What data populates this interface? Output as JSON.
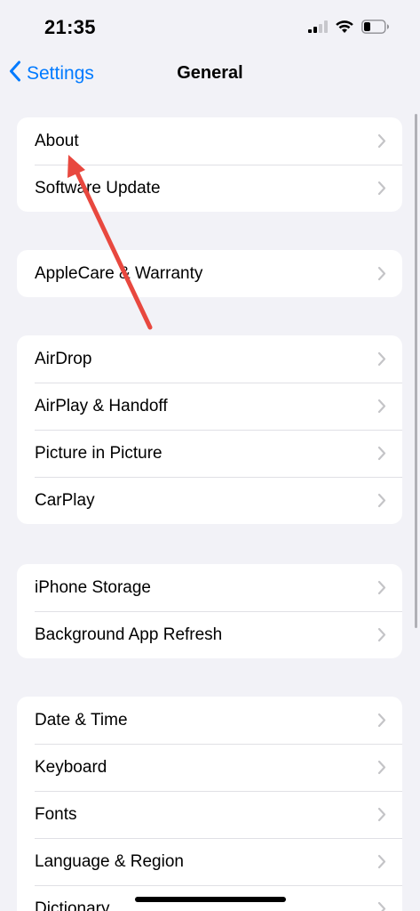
{
  "status_bar": {
    "time": "21:35",
    "icons": [
      "signal-icon",
      "wifi-icon",
      "battery-icon"
    ]
  },
  "nav": {
    "back_label": "Settings",
    "title": "General"
  },
  "groups": [
    {
      "items": [
        {
          "label": "About"
        },
        {
          "label": "Software Update"
        }
      ]
    },
    {
      "items": [
        {
          "label": "AppleCare & Warranty"
        }
      ]
    },
    {
      "items": [
        {
          "label": "AirDrop"
        },
        {
          "label": "AirPlay & Handoff"
        },
        {
          "label": "Picture in Picture"
        },
        {
          "label": "CarPlay"
        }
      ]
    },
    {
      "items": [
        {
          "label": "iPhone Storage"
        },
        {
          "label": "Background App Refresh"
        }
      ]
    },
    {
      "items": [
        {
          "label": "Date & Time"
        },
        {
          "label": "Keyboard"
        },
        {
          "label": "Fonts"
        },
        {
          "label": "Language & Region"
        },
        {
          "label": "Dictionary"
        }
      ]
    }
  ],
  "colors": {
    "accent": "#007aff",
    "background": "#f2f2f7",
    "annotation_arrow": "#e8483f"
  }
}
